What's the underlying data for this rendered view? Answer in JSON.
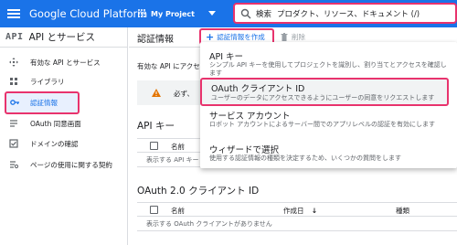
{
  "topbar": {
    "brand": "Google Cloud Platform",
    "project": "My Project",
    "search_label": "検索",
    "search_placeholder": "プロダクト、リソース、ドキュメント (/)"
  },
  "nav": {
    "logo": "API",
    "title": "API とサービス",
    "items": [
      {
        "label": "有効な API とサービス",
        "icon": "diamond-arrows-icon"
      },
      {
        "label": "ライブラリ",
        "icon": "library-grid-icon"
      },
      {
        "label": "認証情報",
        "icon": "key-icon",
        "active": true
      },
      {
        "label": "OAuth 同意画面",
        "icon": "consent-list-icon"
      },
      {
        "label": "ドメインの確認",
        "icon": "checkbox-icon"
      },
      {
        "label": "ページの使用に関する契約",
        "icon": "settings-list-icon"
      }
    ]
  },
  "main": {
    "title": "認証情報",
    "create_label": "認証情報を作成",
    "delete_label": "削除",
    "under_text": "有効な API にアクセ",
    "warning_text": "必ず、",
    "api_keys": {
      "title": "API キー",
      "col_name": "名前",
      "empty": "表示する API キー"
    },
    "oauth": {
      "title": "OAuth 2.0 クライアント ID",
      "col_name": "名前",
      "col_created": "作成日",
      "col_type": "種類",
      "empty": "表示する OAuth クライアントがありません"
    }
  },
  "dropdown": {
    "items": [
      {
        "title": "API キー",
        "desc": "シンプル API キーを使用してプロジェクトを識別し、割り当てとアクセスを確認します"
      },
      {
        "title": "OAuth クライアント ID",
        "desc": "ユーザーのデータにアクセスできるようにユーザーの同意をリクエストします",
        "highlighted": true
      },
      {
        "title": "サービス アカウント",
        "desc": "ロボット アカウントによるサーバー間でのアプリレベルの認証を有効にします"
      },
      {
        "title": "ウィザードで選択",
        "desc": "使用する認証情報の種類を決定するため、いくつかの質問をします"
      }
    ]
  },
  "colors": {
    "brand_blue": "#1a73e8",
    "highlight_pink": "#e8336d",
    "warning": "#e37400"
  }
}
